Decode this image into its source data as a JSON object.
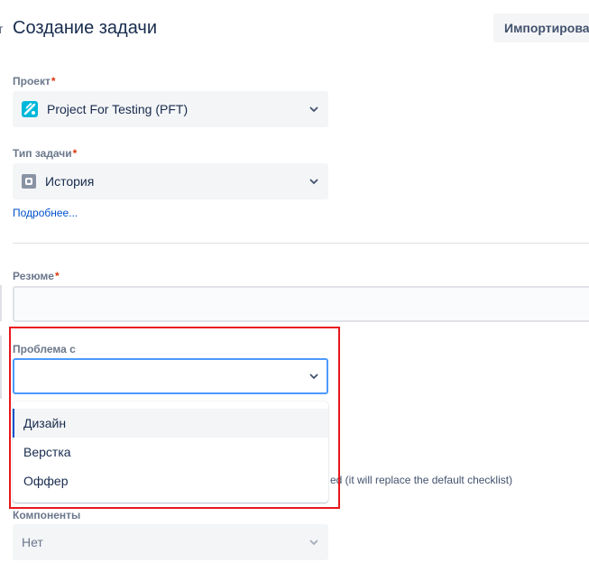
{
  "header": {
    "left_edge_char": "т",
    "title": "Создание задачи",
    "import_label": "Импортирова"
  },
  "fields": {
    "project": {
      "label": "Проект",
      "required": "*",
      "value": "Project For Testing (PFT)",
      "icon": "project-icon"
    },
    "issue_type": {
      "label": "Тип задачи",
      "required": "*",
      "value": "История",
      "icon": "story-icon",
      "more_link": "Подробнее..."
    },
    "summary": {
      "label": "Резюме",
      "required": "*",
      "value": ""
    },
    "problem_with": {
      "label": "Проблема с",
      "value": "",
      "options": [
        "Дизайн",
        "Верстка",
        "Оффер"
      ],
      "highlighted_option": "Дизайн"
    },
    "checklist_partial": "ed (it will replace the default checklist)",
    "components": {
      "label": "Компоненты",
      "value": "Нет"
    }
  },
  "colors": {
    "accent": "#0052cc",
    "required": "#de350b",
    "focus_border": "#4c9aff",
    "annotation_box": "#e8171d"
  }
}
